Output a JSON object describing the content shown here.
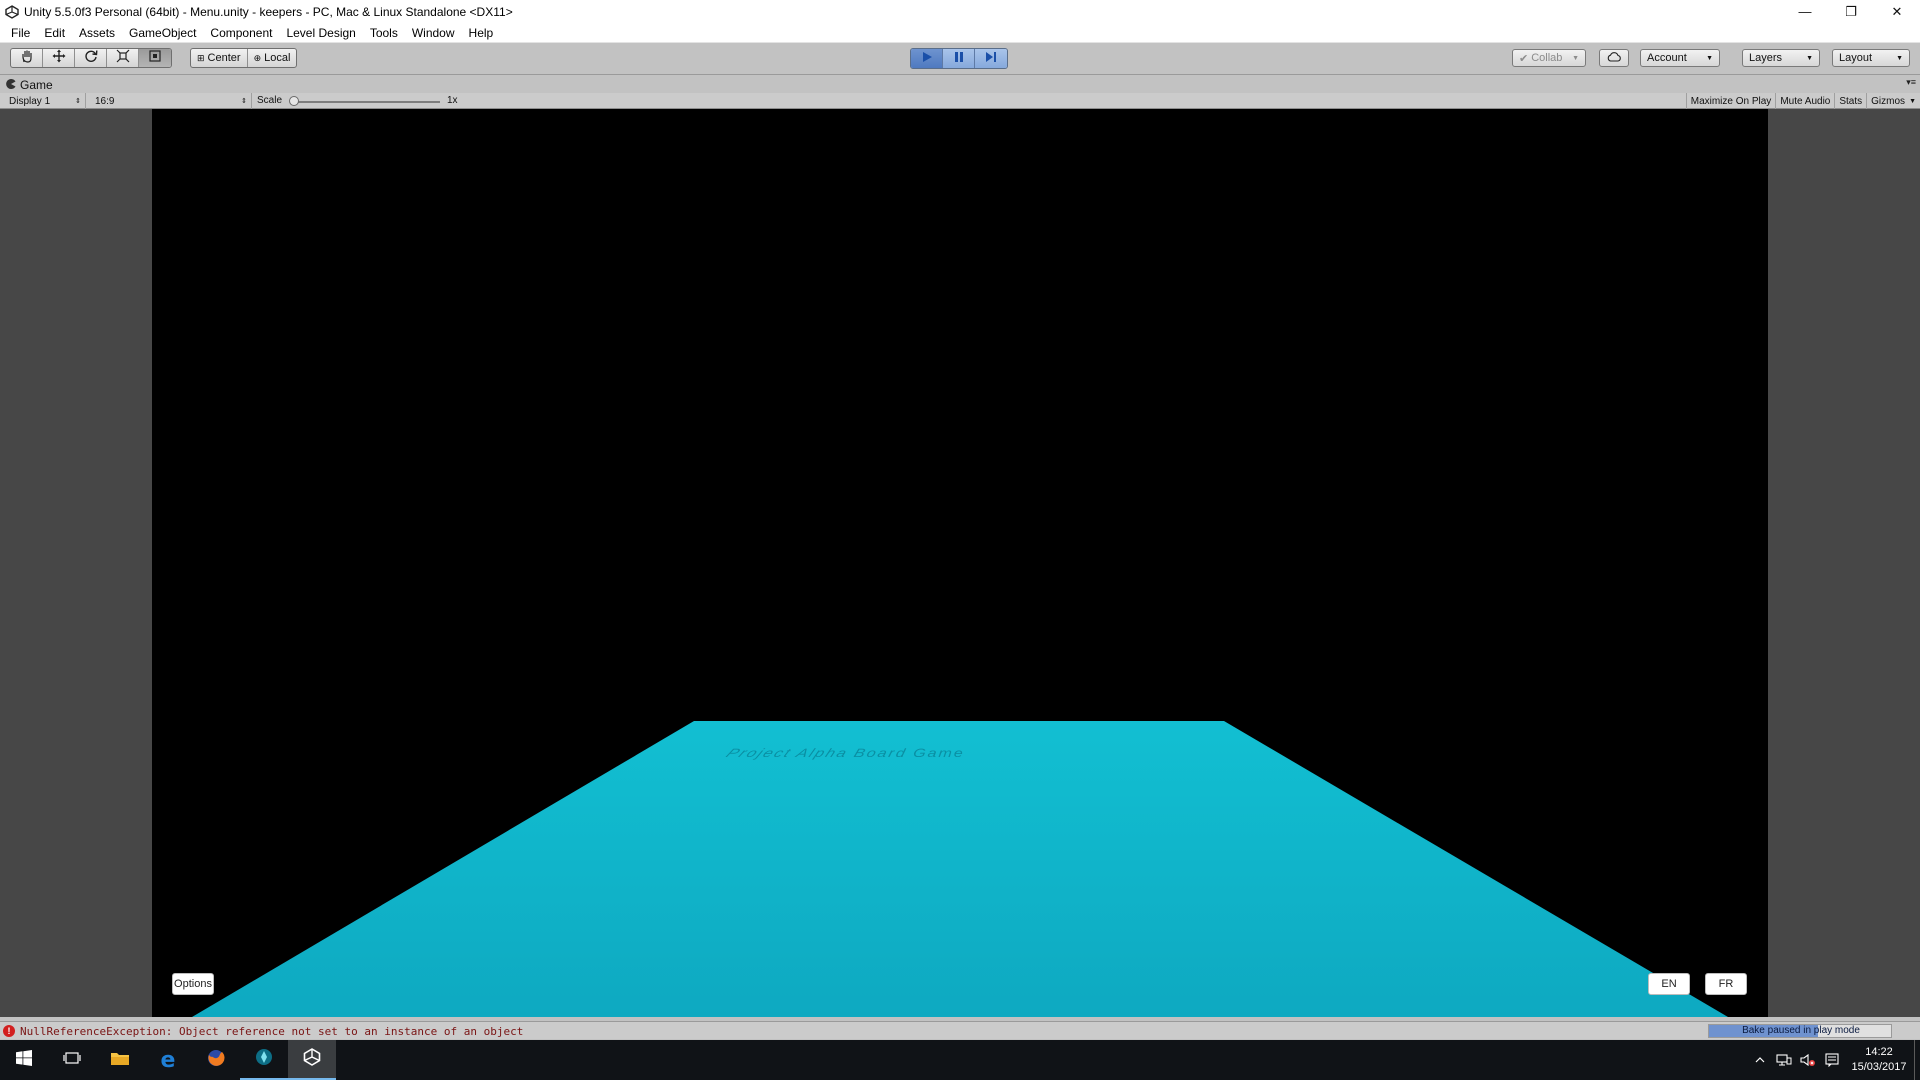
{
  "window": {
    "title": "Unity 5.5.0f3 Personal (64bit) - Menu.unity - keepers - PC, Mac & Linux Standalone <DX11>",
    "minimize_glyph": "—",
    "restore_glyph": "❐",
    "close_glyph": "✕"
  },
  "menu": [
    "File",
    "Edit",
    "Assets",
    "GameObject",
    "Component",
    "Level Design",
    "Tools",
    "Window",
    "Help"
  ],
  "toolbar": {
    "transform_tools": [
      {
        "name": "hand-tool",
        "icon": "hand-icon"
      },
      {
        "name": "move-tool",
        "icon": "move-icon"
      },
      {
        "name": "rotate-tool",
        "icon": "rotate-icon"
      },
      {
        "name": "scale-tool",
        "icon": "scale-icon"
      },
      {
        "name": "rect-tool",
        "icon": "rect-icon"
      }
    ],
    "pivot_label": "Center",
    "space_label": "Local",
    "play_state": "playing",
    "collab_label": "Collab",
    "account_label": "Account",
    "layers_label": "Layers",
    "layout_label": "Layout"
  },
  "game_tab": {
    "label": "Game",
    "display": "Display 1",
    "aspect": "16:9",
    "scale_label": "Scale",
    "scale_value": "1x",
    "toggles": [
      "Maximize On Play",
      "Mute Audio",
      "Stats",
      "Gizmos"
    ]
  },
  "game_view": {
    "board_title": "Project Alpha Board Game",
    "options_button": "Options",
    "lang_en": "EN",
    "lang_fr": "FR",
    "board_color": "#10b8cc",
    "background_color": "#000000"
  },
  "status": {
    "error_message": "NullReferenceException: Object reference not set to an instance of an object",
    "bake_text": "Bake paused in play mode",
    "bake_progress": 0.6
  },
  "taskbar": {
    "apps": [
      "start",
      "task-view",
      "file-explorer",
      "edge",
      "firefox",
      "app",
      "unity"
    ],
    "time": "14:22",
    "date": "15/03/2017"
  }
}
